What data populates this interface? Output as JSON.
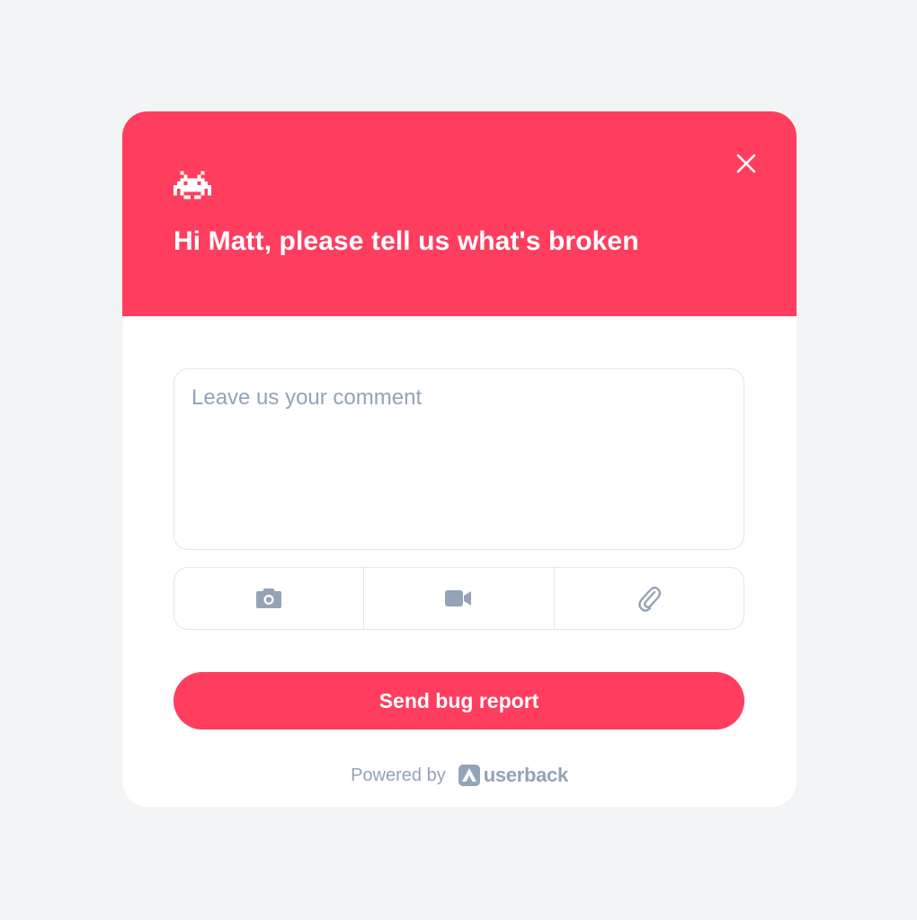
{
  "widget": {
    "header_bg": "#ff3e5f",
    "greeting": "Hi Matt, please tell us what's broken",
    "icons": {
      "header": "space-invader-bug-icon",
      "close": "close-icon"
    }
  },
  "comment": {
    "value": "",
    "placeholder": "Leave us your comment"
  },
  "tools": [
    {
      "icon": "camera-icon"
    },
    {
      "icon": "video-camera-icon"
    },
    {
      "icon": "paperclip-icon"
    }
  ],
  "send_button": {
    "label": "Send bug report",
    "color": "#ff3e5f"
  },
  "footer": {
    "powered_by": "Powered by",
    "brand": "userback",
    "brand_icon": "userback-logo-icon"
  }
}
